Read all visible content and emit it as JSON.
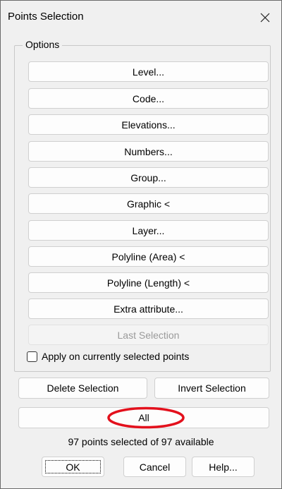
{
  "window": {
    "title": "Points Selection",
    "close_icon": "close-icon"
  },
  "options_group": {
    "label": "Options",
    "buttons": [
      {
        "label": "Level...",
        "enabled": true
      },
      {
        "label": "Code...",
        "enabled": true
      },
      {
        "label": "Elevations...",
        "enabled": true
      },
      {
        "label": "Numbers...",
        "enabled": true
      },
      {
        "label": "Group...",
        "enabled": true
      },
      {
        "label": "Graphic <",
        "enabled": true
      },
      {
        "label": "Layer...",
        "enabled": true
      },
      {
        "label": "Polyline (Area) <",
        "enabled": true
      },
      {
        "label": "Polyline (Length) <",
        "enabled": true
      },
      {
        "label": "Extra attribute...",
        "enabled": true
      },
      {
        "label": "Last Selection",
        "enabled": false
      }
    ],
    "apply_checkbox": {
      "label": "Apply on currently selected points",
      "checked": false
    }
  },
  "selection_actions": {
    "delete_label": "Delete Selection",
    "invert_label": "Invert Selection",
    "all_label": "All"
  },
  "status_text": "97 points selected of 97 available",
  "footer": {
    "ok_label": "OK",
    "cancel_label": "Cancel",
    "help_label": "Help..."
  },
  "annotation": {
    "highlight_color": "#e3101c",
    "highlight_shape": "red ellipse around All button"
  }
}
